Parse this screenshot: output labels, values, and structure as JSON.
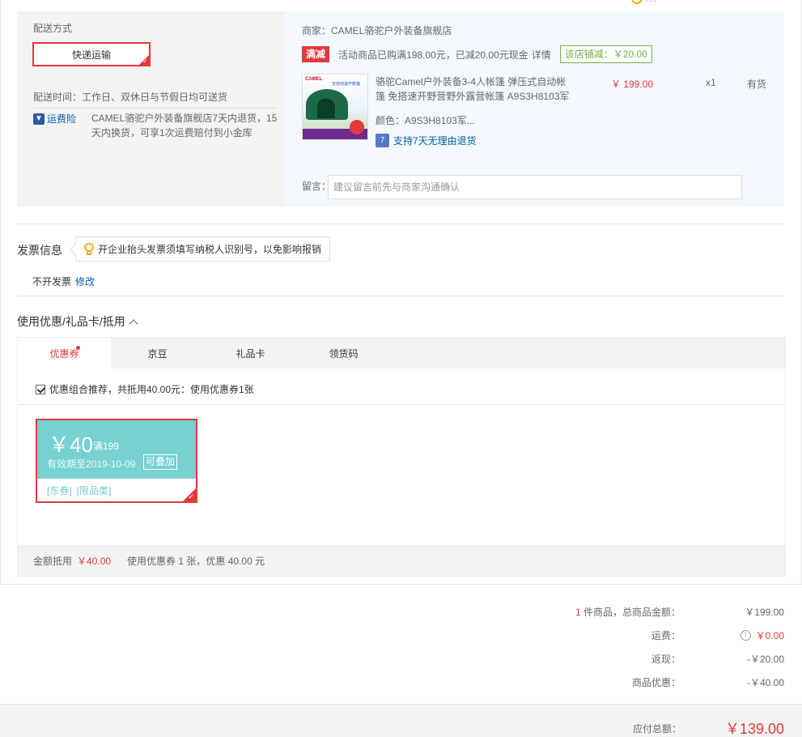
{
  "top": {
    "link_text": "...."
  },
  "shipping": {
    "title": "配送方式",
    "method": "快递运输",
    "time_label": "配送时间：",
    "time_value": "工作日、双休日与节假日均可送货",
    "insurance_label": "运费险",
    "insurance_desc": "CAMEL骆驼户外装备旗舰店7天内退货，15天内换货，可享1次运费赔付到小金库"
  },
  "store": {
    "merchant": "商家：CAMEL骆驼户外装备旗舰店",
    "promo_tag": "满减",
    "promo_text": "活动商品已购满198.00元，已减20.00元现金",
    "promo_detail": "详情",
    "promo_save": "该店铺减：￥20.00",
    "product": {
      "image_texts": {
        "logo": "CAMEL",
        "subtitle": "全自动速开帐篷"
      },
      "name": "骆驼Camel户外装备3-4人帐篷 弹压式自动帐篷 免搭速开野营野外露营帐篷 A9S3H8103军",
      "price": "￥ 199.00",
      "qty": "x1",
      "stock": "有货",
      "color": "颜色：A9S3H8103军...",
      "return_policy": "支持7天无理由退货",
      "return_icon": "7"
    },
    "note_label": "留言：",
    "note_placeholder": "建议留言前先与商家沟通确认"
  },
  "invoice": {
    "title": "发票信息",
    "tip": "开企业抬头发票须填写纳税人识别号，以免影响报销",
    "status": "不开发票",
    "edit": "修改"
  },
  "coupons": {
    "title": "使用优惠/礼品卡/抵用",
    "tabs": [
      {
        "label": "优惠券",
        "active": true
      },
      {
        "label": "京豆",
        "active": false
      },
      {
        "label": "礼品卡",
        "active": false
      },
      {
        "label": "领货码",
        "active": false
      }
    ],
    "combo_text": "优惠组合推荐，共抵用40.00元：使用优惠券1张",
    "combo_checked": true,
    "coupon": {
      "amount": "￥40",
      "condition": "满199",
      "expiry": "有效期至2019-10-09",
      "stackable": "可叠加",
      "tags": [
        "[东券]",
        "[限品类]"
      ],
      "color": "#77d1d1"
    },
    "footer_label": "金额抵用",
    "footer_amount": "￥40.00",
    "footer_used": "使用优惠券 1 张，优惠 40.00 元"
  },
  "summary": {
    "items_count": "1",
    "items_label": " 件商品，总商品金额：",
    "items_value": "￥199.00",
    "shipping_label": "运费：",
    "shipping_value": "￥0.00",
    "cashback_label": "返现：",
    "cashback_value": "-￥20.00",
    "discount_label": "商品优惠：",
    "discount_value": "-￥40.00",
    "total_label": "应付总额：",
    "total_value": "￥139.00"
  },
  "colors": {
    "accent": "#e4393c",
    "link": "#005ea7",
    "coupon": "#77d1d1",
    "save": "#71b247"
  }
}
